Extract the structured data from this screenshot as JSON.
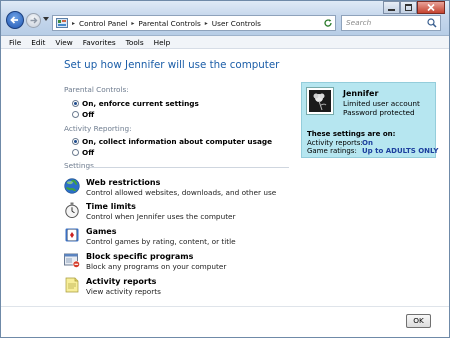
{
  "addressbar": {
    "crumbs": [
      "Control Panel",
      "Parental Controls",
      "User Controls"
    ]
  },
  "search": {
    "placeholder": "Search"
  },
  "menu": [
    "File",
    "Edit",
    "View",
    "Favorites",
    "Tools",
    "Help"
  ],
  "heading": "Set up how Jennifer will use the computer",
  "parental_controls": {
    "label": "Parental Controls:",
    "options": [
      {
        "label": "On, enforce current settings",
        "selected": true
      },
      {
        "label": "Off",
        "selected": false
      }
    ]
  },
  "activity_reporting": {
    "label": "Activity Reporting:",
    "options": [
      {
        "label": "On, collect information about computer usage",
        "selected": true
      },
      {
        "label": "Off",
        "selected": false
      }
    ]
  },
  "settings": {
    "label": "Settings",
    "items": [
      {
        "title": "Web restrictions",
        "desc": "Control allowed websites, downloads, and other use",
        "icon": "globe-icon"
      },
      {
        "title": "Time limits",
        "desc": "Control when Jennifer uses the computer",
        "icon": "stopwatch-icon"
      },
      {
        "title": "Games",
        "desc": "Control games by rating, content, or title",
        "icon": "playing-card-icon"
      },
      {
        "title": "Block specific programs",
        "desc": "Block any programs on your computer",
        "icon": "program-window-icon"
      },
      {
        "title": "Activity reports",
        "desc": "View activity reports",
        "icon": "report-document-icon"
      }
    ]
  },
  "user": {
    "name": "Jennifer",
    "account_type": "Limited user account",
    "password_status": "Password protected",
    "settings_on_label": "These settings are on:",
    "rows": [
      {
        "label": "Activity reports:",
        "value": "On"
      },
      {
        "label": "Game ratings:",
        "value": "Up to ADULTS ONLY"
      }
    ]
  },
  "ok_label": "OK",
  "colors": {
    "heading": "#1c5ea8",
    "user_panel": "#b6e6f0",
    "value_text": "#1c3f9e"
  }
}
